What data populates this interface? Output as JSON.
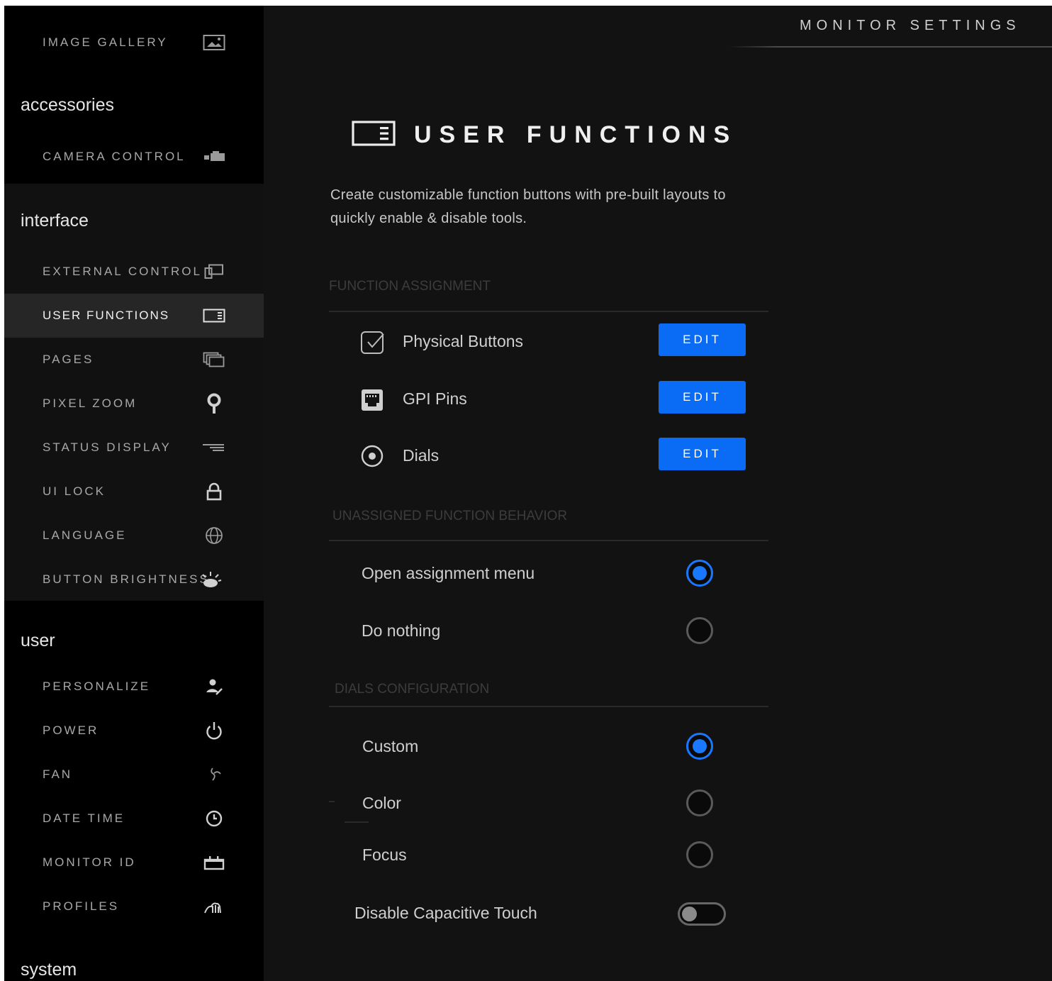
{
  "header": {
    "title": "MONITOR SETTINGS"
  },
  "sidebar": {
    "top_items": [
      {
        "label": "IMAGE GALLERY",
        "icon": "image-icon"
      }
    ],
    "sections": [
      {
        "title": "accessories",
        "items": [
          {
            "label": "CAMERA CONTROL",
            "icon": "camera-icon"
          }
        ]
      },
      {
        "title": "interface",
        "items": [
          {
            "label": "EXTERNAL CONTROL",
            "icon": "external-control-icon"
          },
          {
            "label": "USER FUNCTIONS",
            "icon": "user-functions-icon",
            "selected": true
          },
          {
            "label": "PAGES",
            "icon": "pages-icon"
          },
          {
            "label": "PIXEL ZOOM",
            "icon": "pin-icon"
          },
          {
            "label": "STATUS DISPLAY",
            "icon": "status-display-icon"
          },
          {
            "label": "UI LOCK",
            "icon": "lock-icon"
          },
          {
            "label": "LANGUAGE",
            "icon": "globe-icon"
          },
          {
            "label": "BUTTON BRIGHTNESS",
            "icon": "brightness-icon"
          }
        ]
      },
      {
        "title": "user",
        "items": [
          {
            "label": "PERSONALIZE",
            "icon": "personalize-icon"
          },
          {
            "label": "POWER",
            "icon": "power-icon"
          },
          {
            "label": "FAN",
            "icon": "fan-icon"
          },
          {
            "label": "DATE TIME",
            "icon": "clock-icon"
          },
          {
            "label": "MONITOR ID",
            "icon": "monitor-id-icon"
          },
          {
            "label": "PROFILES",
            "icon": "profiles-icon"
          }
        ]
      },
      {
        "title": "system",
        "items": []
      }
    ]
  },
  "main": {
    "title": "USER FUNCTIONS",
    "title_icon": "user-functions-icon",
    "description": "Create customizable function buttons with pre-built layouts to quickly enable & disable tools.",
    "function_assignment": {
      "heading": "FUNCTION ASSIGNMENT",
      "rows": [
        {
          "label": "Physical Buttons",
          "icon": "checkbox-icon",
          "button": "EDIT"
        },
        {
          "label": "GPI Pins",
          "icon": "gpi-port-icon",
          "button": "EDIT"
        },
        {
          "label": "Dials",
          "icon": "dial-icon",
          "button": "EDIT"
        }
      ]
    },
    "unassigned_behavior": {
      "heading": "UNASSIGNED FUNCTION BEHAVIOR",
      "options": [
        {
          "label": "Open assignment menu",
          "selected": true
        },
        {
          "label": "Do nothing",
          "selected": false
        }
      ]
    },
    "dials_configuration": {
      "heading": "DIALS CONFIGURATION",
      "options": [
        {
          "label": "Custom",
          "selected": true
        },
        {
          "label": "Color",
          "selected": false
        },
        {
          "label": "Focus",
          "selected": false
        }
      ]
    },
    "capacitive_touch": {
      "label": "Disable Capacitive Touch",
      "enabled": false
    }
  },
  "colors": {
    "accent": "#0a6cf5",
    "radio_on": "#1a78ff",
    "background": "#121212",
    "sidebar": "#000000"
  }
}
